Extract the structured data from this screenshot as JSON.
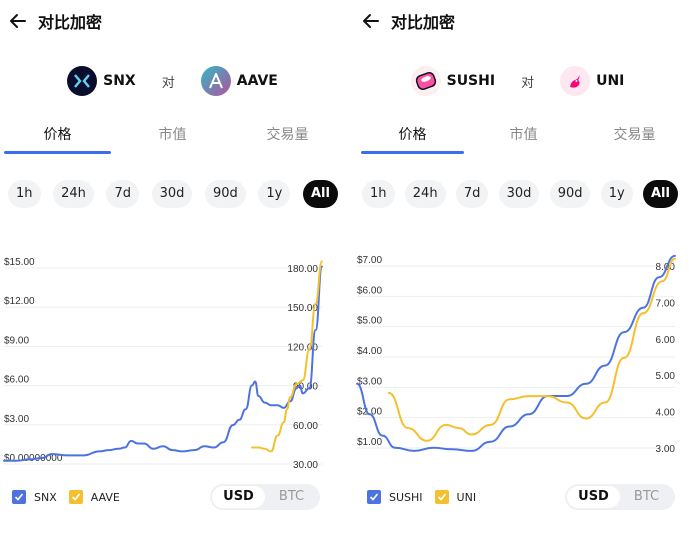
{
  "colors": {
    "blue": "#4d73e0",
    "yellow": "#f4c02f",
    "accent": "#3a6df0"
  },
  "panels": [
    {
      "title": "对比加密",
      "coin_a": {
        "name": "SNX",
        "icon": "snx-logo-icon"
      },
      "vs": "对",
      "coin_b": {
        "name": "AAVE",
        "icon": "aave-logo-icon"
      },
      "tabs": [
        "价格",
        "市值",
        "交易量"
      ],
      "active_tab": 0,
      "ranges": [
        "1h",
        "24h",
        "7d",
        "30d",
        "90d",
        "1y",
        "All"
      ],
      "active_range": "All",
      "legend": [
        "SNX",
        "AAVE"
      ],
      "currency": [
        "USD",
        "BTC"
      ],
      "active_currency": "USD"
    },
    {
      "title": "对比加密",
      "coin_a": {
        "name": "SUSHI",
        "icon": "sushi-logo-icon"
      },
      "vs": "对",
      "coin_b": {
        "name": "UNI",
        "icon": "uni-logo-icon"
      },
      "tabs": [
        "价格",
        "市值",
        "交易量"
      ],
      "active_tab": 0,
      "ranges": [
        "1h",
        "24h",
        "7d",
        "30d",
        "90d",
        "1y",
        "All"
      ],
      "active_range": "All",
      "legend": [
        "SUSHI",
        "UNI"
      ],
      "currency": [
        "USD",
        "BTC"
      ],
      "active_currency": "USD"
    }
  ],
  "chart_data": [
    {
      "type": "line",
      "left_axis": {
        "ticks": [
          "$15.00",
          "$12.00",
          "$9.00",
          "$6.00",
          "$3.00",
          "$0.00000000"
        ],
        "range": [
          0,
          15
        ]
      },
      "right_axis": {
        "ticks": [
          "180.00",
          "150.00",
          "120.00",
          "90.00",
          "60.00",
          "30.00"
        ],
        "range": [
          30,
          180
        ]
      },
      "series": [
        {
          "name": "SNX",
          "axis": "left",
          "color": "#4d73e0",
          "x": [
            0,
            0.04,
            0.08,
            0.12,
            0.15,
            0.2,
            0.25,
            0.3,
            0.33,
            0.36,
            0.38,
            0.4,
            0.42,
            0.44,
            0.47,
            0.5,
            0.53,
            0.56,
            0.6,
            0.63,
            0.66,
            0.69,
            0.72,
            0.74,
            0.76,
            0.78,
            0.79,
            0.8,
            0.82,
            0.84,
            0.86,
            0.88,
            0.9,
            0.92,
            0.93,
            0.94,
            0.96,
            0.98,
            1.0
          ],
          "values": [
            0.1,
            0.1,
            0.2,
            0.3,
            0.6,
            0.5,
            0.5,
            0.8,
            0.9,
            1.0,
            1.1,
            1.6,
            1.4,
            1.4,
            1.0,
            1.2,
            0.9,
            0.8,
            0.9,
            1.2,
            1.1,
            1.5,
            2.8,
            3.2,
            4.0,
            5.8,
            6.1,
            5.0,
            4.5,
            4.3,
            4.3,
            4.1,
            4.6,
            5.6,
            5.8,
            5.2,
            5.6,
            10.0,
            14.8
          ]
        },
        {
          "name": "AAVE",
          "axis": "right",
          "color": "#f4c02f",
          "x": [
            0.78,
            0.8,
            0.82,
            0.84,
            0.86,
            0.88,
            0.89,
            0.9,
            0.92,
            0.94,
            0.96,
            0.98,
            1.0
          ],
          "values": [
            41,
            41,
            40,
            38,
            50,
            60,
            70,
            79,
            89,
            92,
            115,
            150,
            182
          ]
        }
      ]
    },
    {
      "type": "line",
      "left_axis": {
        "ticks": [
          "$7.00",
          "$6.00",
          "$5.00",
          "$4.00",
          "$3.00",
          "$2.00",
          "$1.00"
        ],
        "range": [
          0.5,
          7
        ]
      },
      "right_axis": {
        "ticks": [
          "8.00",
          "7.00",
          "6.00",
          "5.00",
          "4.00",
          "3.00"
        ],
        "range": [
          2.0,
          8.2
        ]
      },
      "series": [
        {
          "name": "SUSHI",
          "axis": "left",
          "color": "#4d73e0",
          "x": [
            0,
            0.04,
            0.08,
            0.12,
            0.18,
            0.24,
            0.3,
            0.36,
            0.42,
            0.48,
            0.54,
            0.6,
            0.66,
            0.72,
            0.78,
            0.84,
            0.9,
            0.95,
            1.0
          ],
          "values": [
            3.0,
            2.0,
            1.3,
            0.9,
            0.8,
            0.9,
            0.85,
            0.8,
            1.1,
            1.6,
            2.0,
            2.6,
            2.6,
            3.0,
            3.6,
            4.7,
            5.5,
            6.5,
            7.2
          ]
        },
        {
          "name": "UNI",
          "axis": "right",
          "color": "#f4c02f",
          "x": [
            0.1,
            0.16,
            0.22,
            0.28,
            0.32,
            0.36,
            0.42,
            0.48,
            0.54,
            0.6,
            0.66,
            0.72,
            0.78,
            0.84,
            0.9,
            0.96,
            1.0
          ],
          "values": [
            4.1,
            3.0,
            2.6,
            3.1,
            3.0,
            2.8,
            3.1,
            3.9,
            4.0,
            4.0,
            3.8,
            3.3,
            3.8,
            5.2,
            6.6,
            7.6,
            8.3
          ]
        }
      ]
    }
  ]
}
